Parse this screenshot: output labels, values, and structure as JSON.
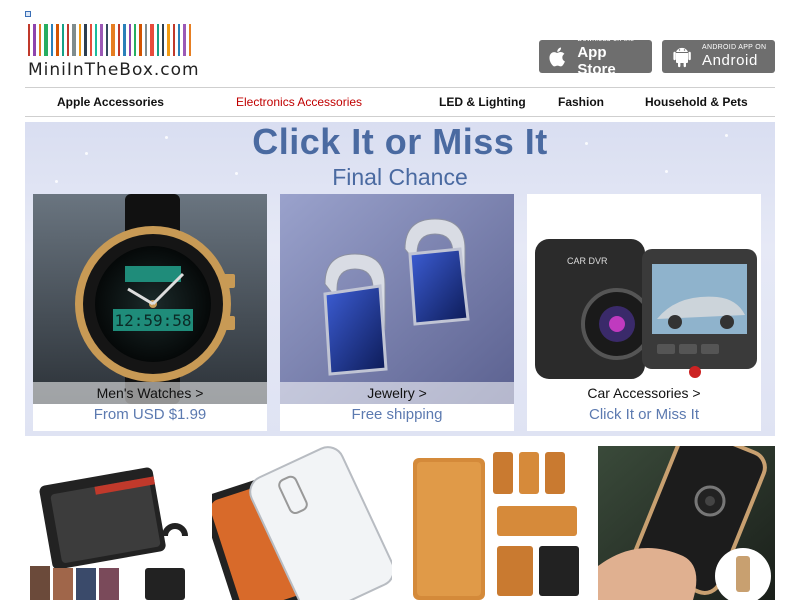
{
  "header": {
    "logo_text": "MiniInTheBox.com",
    "barcode_colors": [
      "#c0392b",
      "#8e44ad",
      "#e67e22",
      "#27ae60",
      "#2980b9",
      "#d35400",
      "#16a085",
      "#c0392b",
      "#7f8c8d",
      "#f39c12",
      "#2c3e50",
      "#e74c3c",
      "#1abc9c",
      "#9b59b6",
      "#34495e",
      "#e67e22",
      "#c0392b",
      "#2980b9",
      "#8e44ad",
      "#27ae60",
      "#d35400",
      "#7f8c8d",
      "#e74c3c",
      "#16a085",
      "#2c3e50",
      "#f39c12",
      "#c0392b",
      "#2980b9",
      "#9b59b6",
      "#e67e22"
    ],
    "app_store": {
      "small": "Download on the",
      "big": "App Store",
      "icon": "apple-icon"
    },
    "android": {
      "small": "ANDROID APP ON",
      "big": "Android",
      "icon": "android-icon"
    }
  },
  "nav": {
    "items": [
      {
        "label": "Apple Accessories",
        "active": false
      },
      {
        "label": "Electronics Accessories",
        "active": true
      },
      {
        "label": "LED & Lighting",
        "active": false
      },
      {
        "label": "Fashion",
        "active": false
      },
      {
        "label": "Household & Pets",
        "active": false
      }
    ]
  },
  "banner": {
    "title": "Click It or Miss It",
    "subtitle": "Final Chance",
    "accent_color": "#4a6aa1",
    "promos": [
      {
        "label": "Men's Watches >",
        "caption": "From USD $1.99",
        "image": "watch-image"
      },
      {
        "label": "Jewelry >",
        "caption": "Free shipping",
        "image": "earrings-image"
      },
      {
        "label": "Car Accessories >",
        "caption": "Click It or Miss It",
        "image": "dash-cam-image"
      }
    ]
  },
  "products": [
    {
      "image": "leather-flip-case-image"
    },
    {
      "image": "clear-phone-case-image"
    },
    {
      "image": "wallet-phone-case-image"
    },
    {
      "image": "kickstand-phone-case-image"
    }
  ]
}
